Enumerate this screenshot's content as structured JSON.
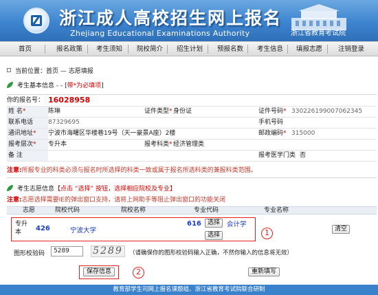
{
  "banner": {
    "title": "浙江成人高校招生网上报名",
    "subtitle_en": "Zhejiang Educational Examinations Authority",
    "org": "浙江省教育考试院"
  },
  "nav": [
    "首页",
    "报名政策",
    "考生须知",
    "院校简介",
    "招生计划",
    "预报名数",
    "考生信息",
    "填报志愿",
    "注销登录"
  ],
  "breadcrumb": {
    "label": "当前位置：",
    "path": "首页 — 志愿填报"
  },
  "basic": {
    "heading": "考生基本信息 - - [",
    "heading_note": "带*为必填项",
    "heading_end": "]",
    "reg_label": "你的报名号：",
    "reg_no": "16028958",
    "name_label": "姓 名",
    "name": "陈琳",
    "idtype_label": "证件类型",
    "idtype": "身份证",
    "idno_label": "证件号码",
    "idno": "330226199007062345",
    "phone_label": "联系电话",
    "phone": "87329695",
    "mobile_label": "手机号码",
    "address_label": "通讯地址",
    "address": "宁波市海曙区华楼巷19号（天一豪景A座）2楼",
    "postcode_label": "邮政编码",
    "postcode": "315000",
    "level_label": "报考层次",
    "level": "专升本",
    "category_label": "报考科类",
    "category": "经济管理类",
    "remark_label": "备 注",
    "medical_label": "报考医学门类",
    "medical": "否",
    "note_label": "注意:",
    "note": "所报专业的科类必须与报名时所选择的科类一致或属于报名所选科类的兼报科类范围。"
  },
  "choice": {
    "heading": "考生志愿信息",
    "heading_hint": "【点击 “选择” 按钮，选择相应院校及专业】",
    "note_label": "注意:",
    "note": "志愿选择需要IE的弹出窗口支持，请将上网助手等阻止弹出窗口的功能关闭",
    "columns": [
      "志愿",
      "院校代码",
      "院校名称",
      "专业代码",
      "专业名称"
    ],
    "row_label": "专升本",
    "school_code": "426",
    "school_name": "宁波大学",
    "major_code": "616",
    "select_label": "选择",
    "major_name": "会计学",
    "select2_label": "选择",
    "clear_label": "清空",
    "callout1": "1",
    "captcha_label": "图形校验码",
    "captcha_value": "5289",
    "captcha_image_text": "5289",
    "captcha_hint": "（请确保你的图形校验码输入正确，不然你输入的信息将无效）",
    "save_label": "保存信息",
    "reset_label": "重新填写",
    "callout2": "2"
  },
  "footer": "教育部学生司网上报名课题组、浙江省教育考试院联合研制"
}
